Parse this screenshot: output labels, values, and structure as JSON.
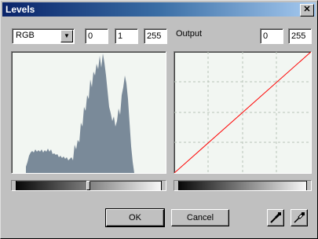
{
  "window": {
    "title": "Levels"
  },
  "channel": {
    "selected": "RGB"
  },
  "input_levels": {
    "black": "0",
    "gamma": "1",
    "white": "255"
  },
  "output": {
    "label": "Output",
    "black": "0",
    "white": "255"
  },
  "input_slider": {
    "gamma_position": 0.5
  },
  "buttons": {
    "ok": "OK",
    "cancel": "Cancel"
  },
  "icons": {
    "close": "close-icon",
    "black_point": "black-eyedropper-icon",
    "white_point": "white-eyedropper-icon"
  },
  "colors": {
    "curve": "#ff0000",
    "histogram": "#7a8a99"
  }
}
